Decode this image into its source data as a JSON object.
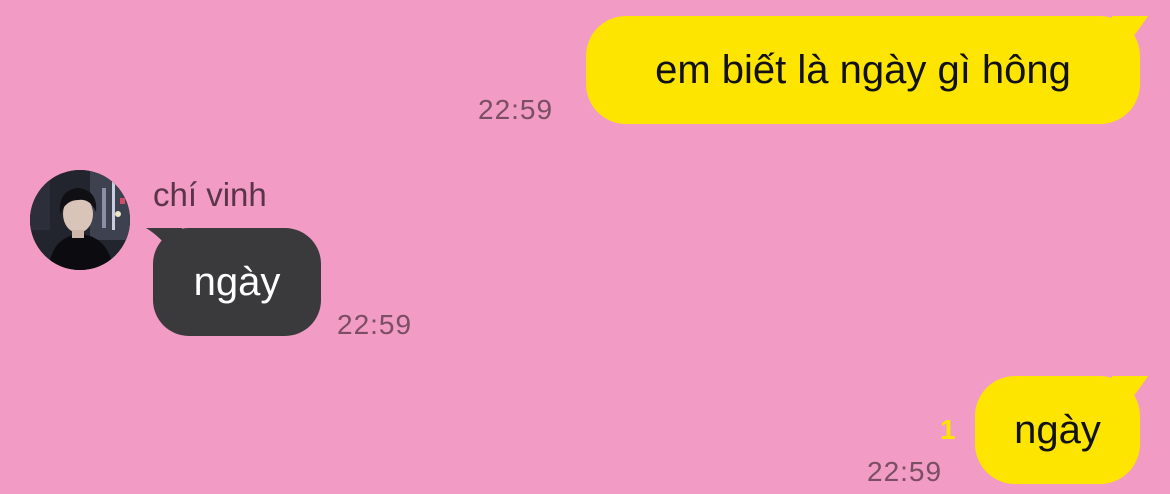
{
  "messages": {
    "outgoing_1": {
      "text": "em biết là ngày gì hông",
      "time": "22:59"
    },
    "incoming_1": {
      "sender": "chí vinh",
      "text": "ngày",
      "time": "22:59"
    },
    "outgoing_2": {
      "text": "ngày",
      "time": "22:59",
      "unread_count": "1"
    }
  },
  "colors": {
    "background": "#f29bc4",
    "outgoing_bubble": "#fee500",
    "incoming_bubble": "#3a3a3c",
    "timestamp": "#7a4e63",
    "unread": "#fee500"
  },
  "icons": {
    "avatar": "profile-photo"
  }
}
